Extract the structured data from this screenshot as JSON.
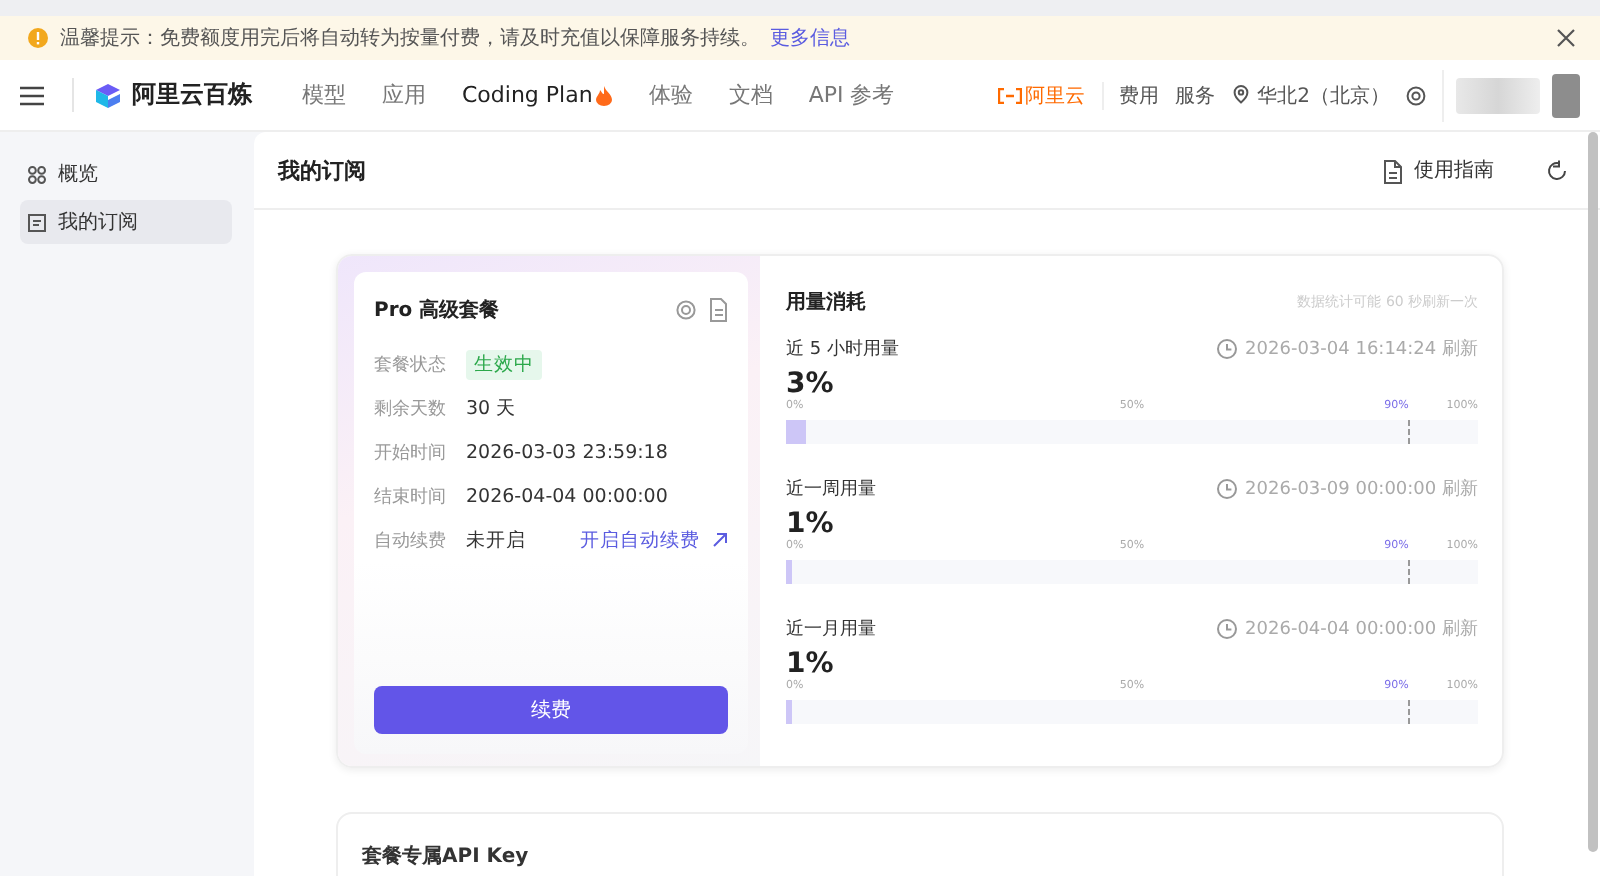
{
  "banner": {
    "text": "温馨提示：免费额度用完后将自动转为按量付费，请及时充值以保障服务持续。",
    "link": "更多信息"
  },
  "nav": {
    "logo": "阿里云百炼",
    "items": [
      {
        "label": "模型",
        "selected": false
      },
      {
        "label": "应用",
        "selected": false
      },
      {
        "label": "Coding Plan",
        "selected": true,
        "hot": true
      },
      {
        "label": "体验",
        "selected": false
      },
      {
        "label": "文档",
        "selected": false
      },
      {
        "label": "API 参考",
        "selected": false
      }
    ],
    "brand": "阿里云",
    "links": [
      "费用",
      "服务"
    ],
    "region": "华北2（北京）"
  },
  "sidebar": {
    "items": [
      {
        "label": "概览",
        "selected": false,
        "kind": "grid"
      },
      {
        "label": "我的订阅",
        "selected": true,
        "kind": "doc"
      }
    ]
  },
  "page": {
    "title": "我的订阅",
    "guide": "使用指南"
  },
  "plan": {
    "title": "Pro 高级套餐",
    "fields": [
      {
        "label": "套餐状态",
        "value": "生效中",
        "kind": "badge"
      },
      {
        "label": "剩余天数",
        "value": "30 天",
        "kind": "text"
      },
      {
        "label": "开始时间",
        "value": "2026-03-03 23:59:18",
        "kind": "text"
      },
      {
        "label": "结束时间",
        "value": "2026-04-04 00:00:00",
        "kind": "text"
      },
      {
        "label": "自动续费",
        "value": "未开启",
        "kind": "link",
        "link": "开启自动续费"
      }
    ],
    "button": "续费"
  },
  "usage": {
    "title": "用量消耗",
    "note": "数据统计可能 60 秒刷新一次",
    "meters": [
      {
        "label": "近 5 小时用量",
        "refresh": "2026-03-04 16:14:24 刷新",
        "percent": "3%",
        "level": 0.03,
        "ticks": [
          "0%",
          "50%",
          "90%",
          "100%"
        ]
      },
      {
        "label": "近一周用量",
        "refresh": "2026-03-09 00:00:00 刷新",
        "percent": "1%",
        "level": 0.01,
        "ticks": [
          "0%",
          "50%",
          "90%",
          "100%"
        ]
      },
      {
        "label": "近一月用量",
        "refresh": "2026-04-04 00:00:00 刷新",
        "percent": "1%",
        "level": 0.01,
        "ticks": [
          "0%",
          "50%",
          "90%",
          "100%"
        ]
      }
    ]
  },
  "api_key": {
    "title": "套餐专属API Key"
  }
}
